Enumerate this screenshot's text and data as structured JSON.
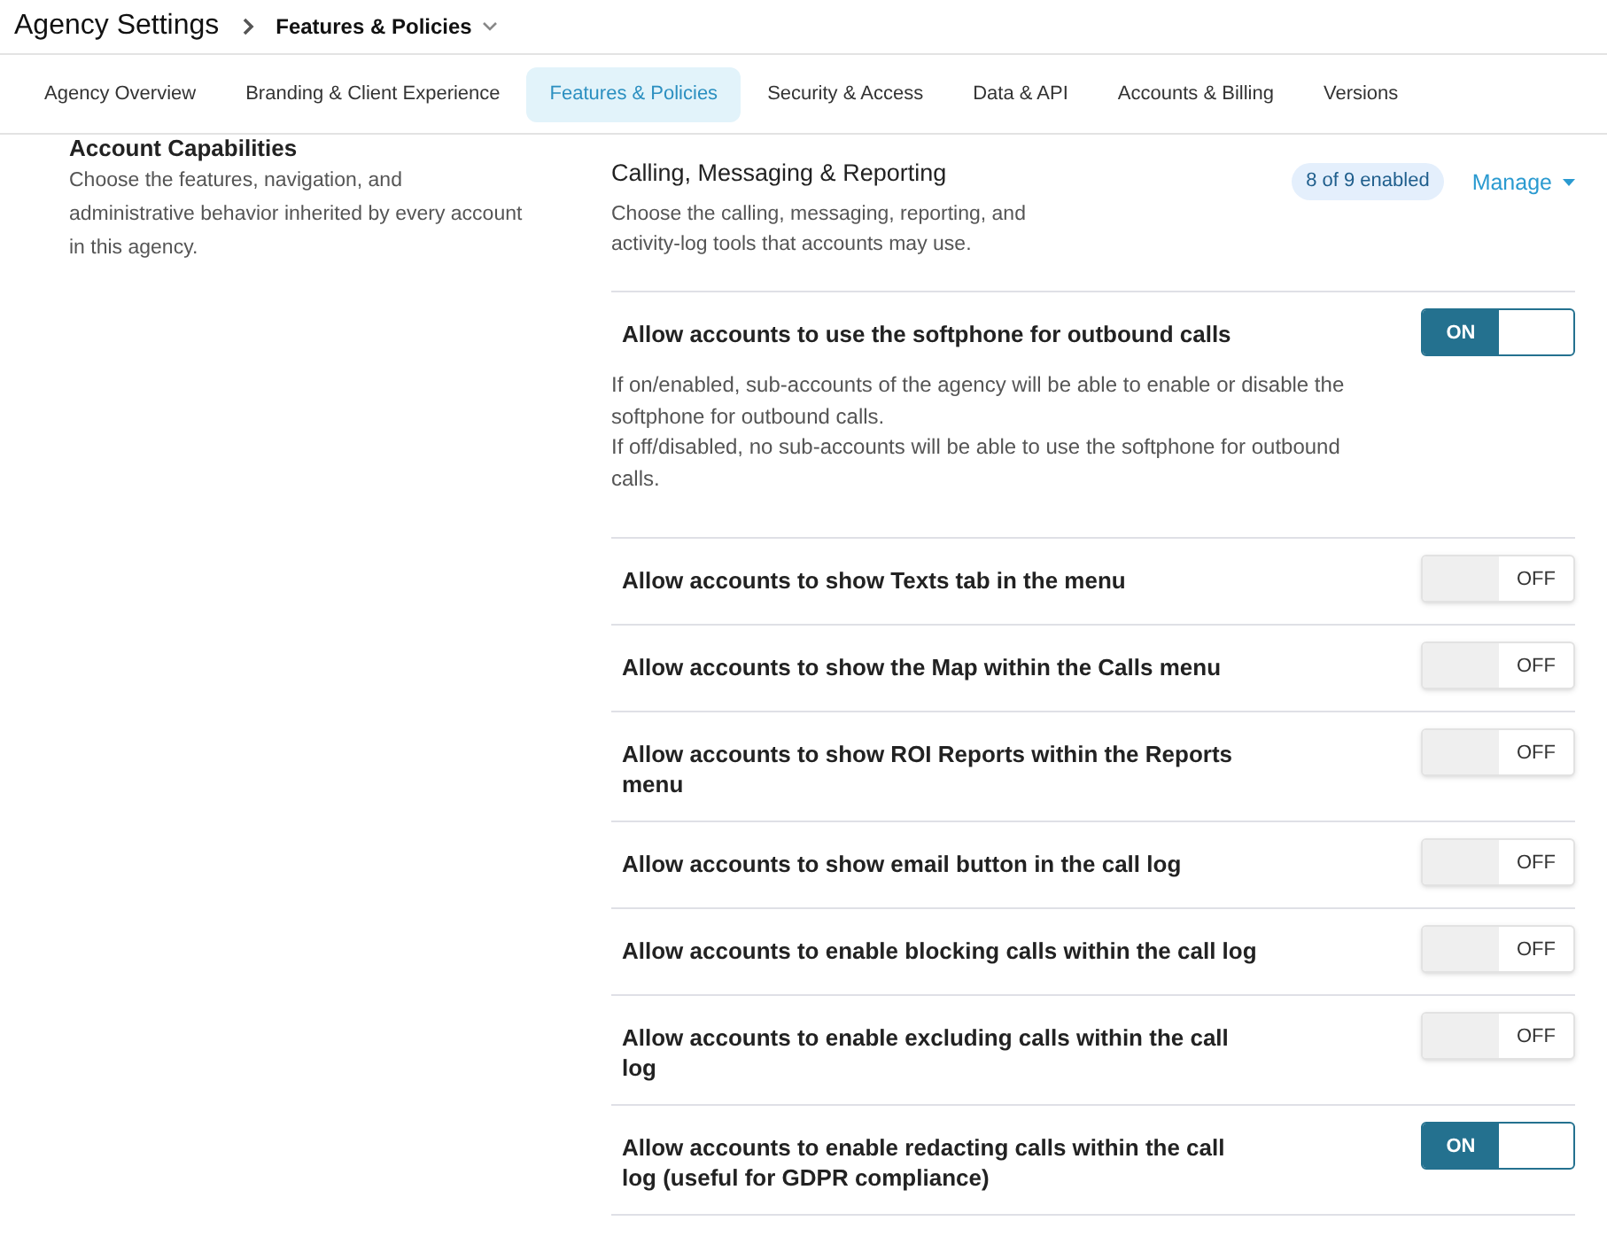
{
  "breadcrumb": {
    "root": "Agency Settings",
    "current": "Features & Policies"
  },
  "tabs": [
    {
      "label": "Agency Overview",
      "selected": false
    },
    {
      "label": "Branding & Client Experience",
      "selected": false
    },
    {
      "label": "Features & Policies",
      "selected": true
    },
    {
      "label": "Security & Access",
      "selected": false
    },
    {
      "label": "Data & API",
      "selected": false
    },
    {
      "label": "Accounts & Billing",
      "selected": false
    },
    {
      "label": "Versions",
      "selected": false
    }
  ],
  "sidebar": {
    "title": "Account Capabilities",
    "description": "Choose the features, navigation, and administrative behavior inherited by every account in this agency."
  },
  "section": {
    "title": "Calling, Messaging & Reporting",
    "description": "Choose the calling, messaging, reporting, and activity-log tools that accounts may use.",
    "badge": "8 of 9 enabled",
    "manage": "Manage"
  },
  "settings": [
    {
      "label": "Allow accounts to use the softphone for outbound calls",
      "on": true,
      "toggle": "ON",
      "description": [
        "If on/enabled, sub-accounts of the agency will be able to enable or disable the softphone for outbound calls.",
        "If off/disabled, no sub-accounts will be able to use the softphone for outbound calls."
      ]
    },
    {
      "label": "Allow accounts to show Texts tab in the menu",
      "on": false,
      "toggle": "OFF"
    },
    {
      "label": "Allow accounts to show the Map within the Calls menu",
      "on": false,
      "toggle": "OFF"
    },
    {
      "label": "Allow accounts to show ROI Reports within the Reports menu",
      "on": false,
      "toggle": "OFF"
    },
    {
      "label": "Allow accounts to show email button in the call log",
      "on": false,
      "toggle": "OFF"
    },
    {
      "label": "Allow accounts to enable blocking calls within the call log",
      "on": false,
      "toggle": "OFF"
    },
    {
      "label": "Allow accounts to enable excluding calls within the call log",
      "on": false,
      "toggle": "OFF"
    },
    {
      "label": "Allow accounts to enable redacting calls within the call log (useful for GDPR compliance)",
      "on": true,
      "toggle": "ON"
    }
  ]
}
